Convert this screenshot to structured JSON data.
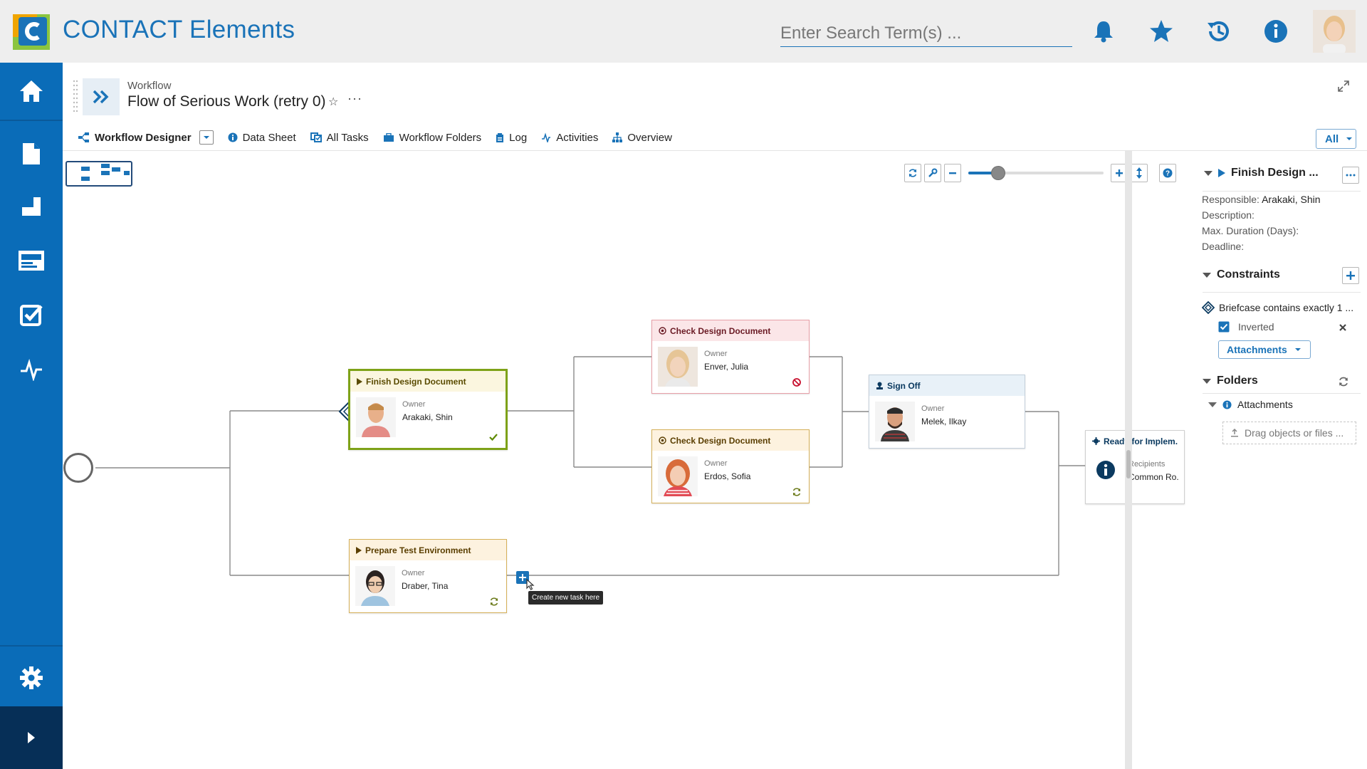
{
  "app": {
    "title": "CONTACT Elements",
    "search_placeholder": "Enter Search Term(s) ..."
  },
  "header_icons": [
    "bell-icon",
    "star-icon",
    "history-icon",
    "info-icon"
  ],
  "sidebar": {
    "items": [
      "home-icon",
      "document-icon",
      "part-icon",
      "dashboard-icon",
      "tasks-icon",
      "activity-icon",
      "settings-icon"
    ],
    "expand_icon": "chevron-right-icon"
  },
  "workflow": {
    "kind": "Workflow",
    "title": "Flow of Serious Work (retry 0)",
    "star": "☆",
    "more": "···"
  },
  "tabs": [
    {
      "label": "Workflow Designer",
      "icon": "designer-icon"
    },
    {
      "label": "Data Sheet",
      "icon": "info-icon"
    },
    {
      "label": "All Tasks",
      "icon": "tasks-icon"
    },
    {
      "label": "Workflow Folders",
      "icon": "folder-icon"
    },
    {
      "label": "Log",
      "icon": "log-icon"
    },
    {
      "label": "Activities",
      "icon": "activity-icon"
    },
    {
      "label": "Overview",
      "icon": "hierarchy-icon"
    }
  ],
  "filter": {
    "value": "All"
  },
  "zoom": {
    "level": 0.22
  },
  "tasks": {
    "finish": {
      "title": "Finish Design Document",
      "owner_label": "Owner",
      "owner": "Arakaki, Shin"
    },
    "check1": {
      "title": "Check Design Document",
      "owner_label": "Owner",
      "owner": "Enver, Julia"
    },
    "check2": {
      "title": "Check Design Document",
      "owner_label": "Owner",
      "owner": "Erdos, Sofia"
    },
    "signoff": {
      "title": "Sign Off",
      "owner_label": "Owner",
      "owner": "Melek, Ilkay"
    },
    "ready": {
      "title": "Ready for Implem.",
      "owner_label": "Recipients",
      "owner": "Common Ro."
    },
    "prepare": {
      "title": "Prepare Test Environment",
      "owner_label": "Owner",
      "owner": "Draber, Tina"
    }
  },
  "tooltip": "Create new task here",
  "panel": {
    "title": "Finish Design ...",
    "responsible_label": "Responsible:",
    "responsible": "Arakaki, Shin",
    "description_label": "Description:",
    "duration_label": "Max. Duration (Days):",
    "deadline_label": "Deadline:",
    "constraints_label": "Constraints",
    "constraint": "Briefcase contains exactly 1 ...",
    "inverted_label": "Inverted",
    "attachments_dd": "Attachments",
    "folders_label": "Folders",
    "folder_item": "Attachments",
    "dropzone": "Drag objects or files ..."
  },
  "colors": {
    "brand": "#1a73b8",
    "sidebar": "#0a6cb8",
    "approved": "#7ea218",
    "rejected": "#c8102e"
  }
}
